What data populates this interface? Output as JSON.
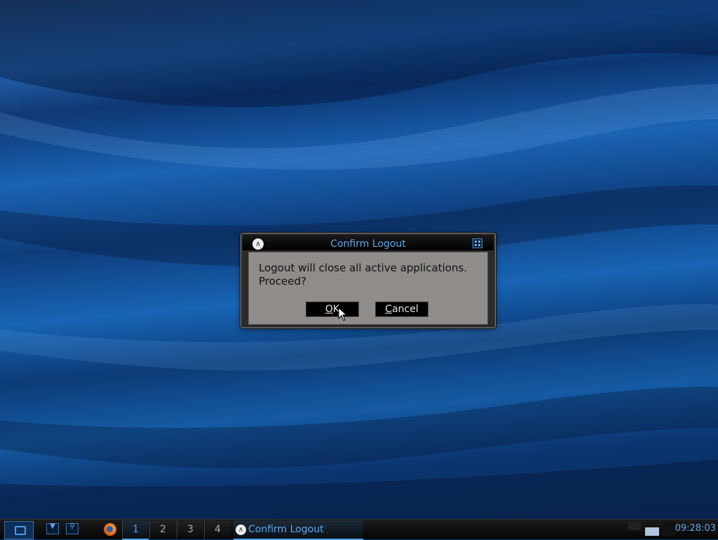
{
  "dialog": {
    "title": "Confirm Logout",
    "message_line1": "Logout will close all active applications.",
    "message_line2": "Proceed?",
    "ok_rest": "K",
    "ok_mnemonic": "O",
    "cancel_mnemonic": "C",
    "cancel_rest": "ancel"
  },
  "taskbar": {
    "workspaces": [
      "1",
      "2",
      "3",
      "4"
    ],
    "active_workspace": "1",
    "task_label": "Confirm Logout",
    "clock": "09:28:03"
  },
  "icons": {
    "start": "start-menu-icon",
    "dropdown": "chevron-down-icon",
    "search": "search-icon",
    "browser": "firefox-icon",
    "app": "app-logo-icon",
    "maximize": "maximize-icon",
    "cursor": "mouse-cursor-icon"
  },
  "colors": {
    "accent": "#5aa7e6",
    "dialog_body": "#8f8c8a",
    "desktop": "#0e3f7d"
  }
}
